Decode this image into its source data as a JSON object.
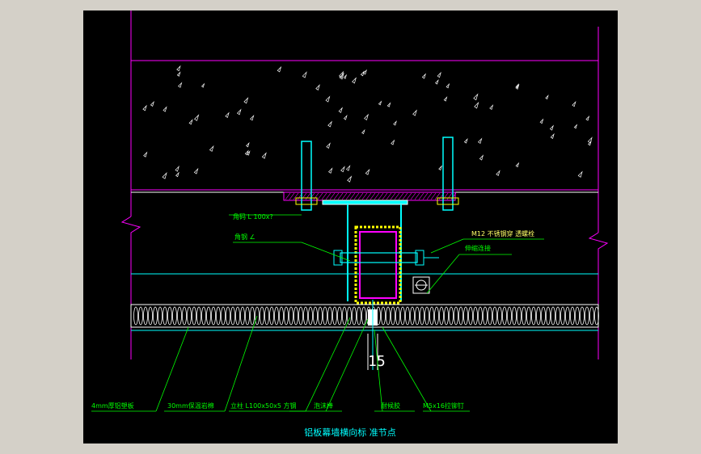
{
  "drawing": {
    "title": "铝板幕墙横向标 准节点",
    "dimension": "15",
    "labels": {
      "top_left_1": "角码 L 100x?",
      "top_left_2": "角钢 ∠",
      "bolt": "M12 不锈钢穿 透螺栓",
      "expansion": "伸缩连接",
      "aluminum_panel": "4mm厚铝塑板",
      "insulation": "30mm保温岩棉",
      "column": "立柱 L100x50x5 方钢",
      "foam_rod": "泡沫棒",
      "sealant": "耐候胶",
      "rivet": "M5x16拉铆钉"
    },
    "colors": {
      "background": "#000000",
      "frame": "#d4d0c8",
      "wall_line": "#ff00ff",
      "concrete": "#ffffff",
      "steel": "#00ffff",
      "label": "#00ff00",
      "title": "#00ffff"
    }
  }
}
